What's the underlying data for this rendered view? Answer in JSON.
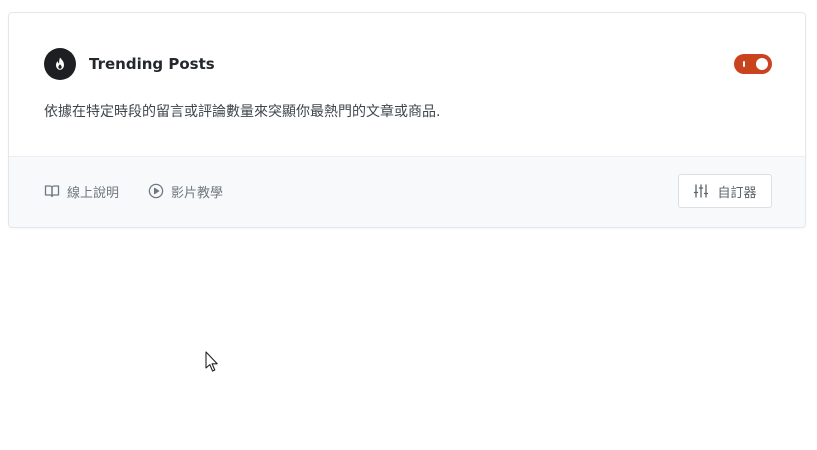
{
  "app": {
    "title": "Trending Posts",
    "icon": "flame-icon",
    "enabled": true,
    "description": "依據在特定時段的留言或評論數量來突顯你最熱門的文章或商品."
  },
  "footer": {
    "docs_label": "線上說明",
    "docs_icon": "book-icon",
    "video_label": "影片教學",
    "video_icon": "play-circle-icon",
    "customize_label": "自訂器",
    "customize_icon": "sliders-icon"
  },
  "colors": {
    "accent": "#c9431f",
    "icon_bg": "#1e1f22",
    "footer_bg": "#f8f9fa"
  }
}
